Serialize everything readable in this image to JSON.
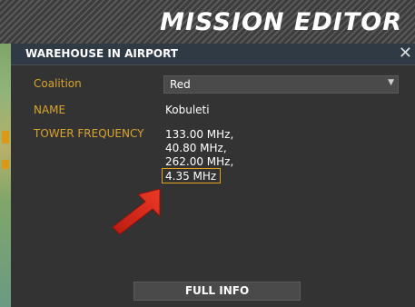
{
  "header": {
    "title": "MISSION EDITOR"
  },
  "dialog": {
    "title": "WAREHOUSE IN AIRPORT",
    "close_icon": "close-icon",
    "coalition": {
      "label": "Coalition",
      "value": "Red"
    },
    "name": {
      "label": "NAME",
      "value": "Kobuleti"
    },
    "tower_frequency": {
      "label": "TOWER FREQUENCY",
      "values": [
        "133.00 MHz,",
        "40.80 MHz,",
        "262.00 MHz,",
        "4.35 MHz"
      ]
    },
    "full_info_label": "FULL INFO"
  },
  "colors": {
    "label": "#d9a42c",
    "highlight": "#e2a21c",
    "annotation_arrow": "#d42a1c"
  }
}
